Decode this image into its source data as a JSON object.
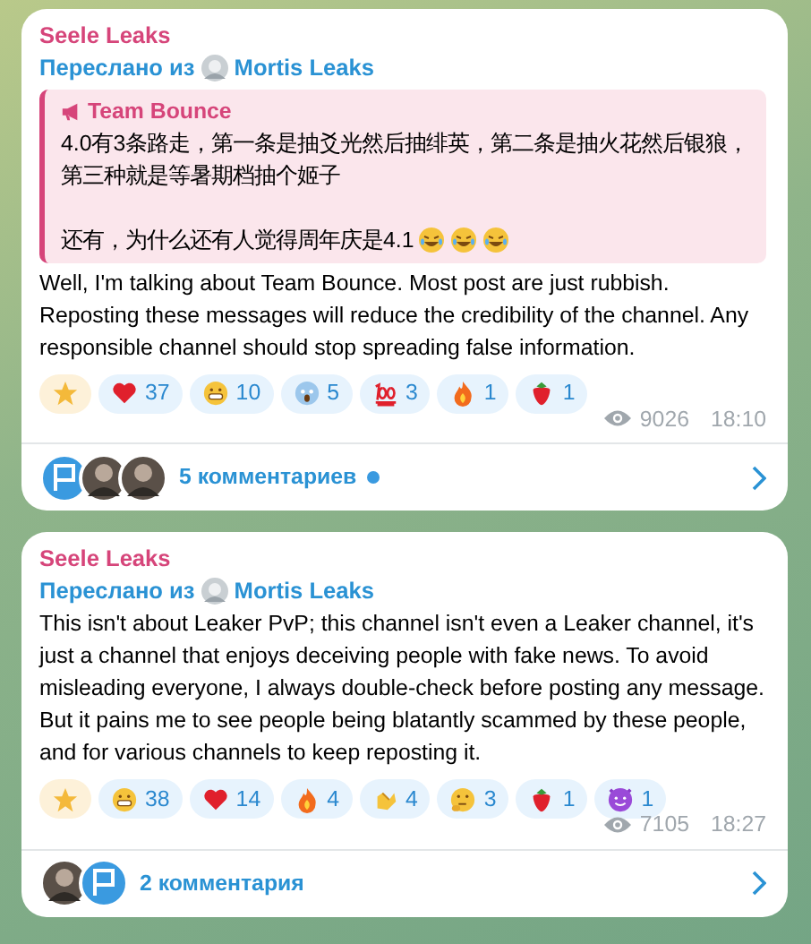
{
  "posts": [
    {
      "author": "Seele Leaks",
      "forwarded_label": "Переслано из",
      "forwarded_from": "Mortis Leaks",
      "quote": {
        "title": "Team Bounce",
        "lines": [
          "4.0有3条路走，第一条是抽爻光然后抽绯英，第二条是抽火花然后银狼，第三种就是等暑期档抽个姬子",
          "还有，为什么还有人觉得周年庆是4.1"
        ],
        "trailing_emoji": [
          {
            "kind": "laugh"
          },
          {
            "kind": "laugh"
          },
          {
            "kind": "laugh"
          }
        ]
      },
      "text": "Well, I'm talking about Team Bounce. Most post are just rubbish. Reposting these messages will reduce the credibility of the channel. Any responsible channel should stop spreading false information.",
      "reactions": [
        {
          "kind": "star"
        },
        {
          "kind": "heart",
          "count": "37"
        },
        {
          "kind": "grin",
          "count": "10"
        },
        {
          "kind": "scream",
          "count": "5"
        },
        {
          "kind": "hundred",
          "count": "3"
        },
        {
          "kind": "fire",
          "count": "1"
        },
        {
          "kind": "strawberry",
          "count": "1"
        }
      ],
      "views": "9026",
      "time": "18:10",
      "commenters": [
        {
          "kind": "flag"
        },
        {
          "kind": "photo"
        },
        {
          "kind": "photo"
        }
      ],
      "comments": "5 комментариев",
      "unread": true
    },
    {
      "author": "Seele Leaks",
      "forwarded_label": "Переслано из",
      "forwarded_from": "Mortis Leaks",
      "text": "This isn't about Leaker PvP; this channel isn't even a Leaker channel, it's just a channel that enjoys deceiving people with fake news. To avoid misleading everyone, I always double-check before posting any message. But it pains me to see people being blatantly scammed by these people, and for various channels to keep reposting it.",
      "reactions": [
        {
          "kind": "star"
        },
        {
          "kind": "grin",
          "count": "38"
        },
        {
          "kind": "heart",
          "count": "14"
        },
        {
          "kind": "fire",
          "count": "4"
        },
        {
          "kind": "clap",
          "count": "4"
        },
        {
          "kind": "thinking",
          "count": "3"
        },
        {
          "kind": "strawberry",
          "count": "1"
        },
        {
          "kind": "devil",
          "count": "1"
        }
      ],
      "views": "7105",
      "time": "18:27",
      "commenters": [
        {
          "kind": "photo"
        },
        {
          "kind": "flag"
        }
      ],
      "comments": "2 комментария",
      "unread": false
    }
  ]
}
